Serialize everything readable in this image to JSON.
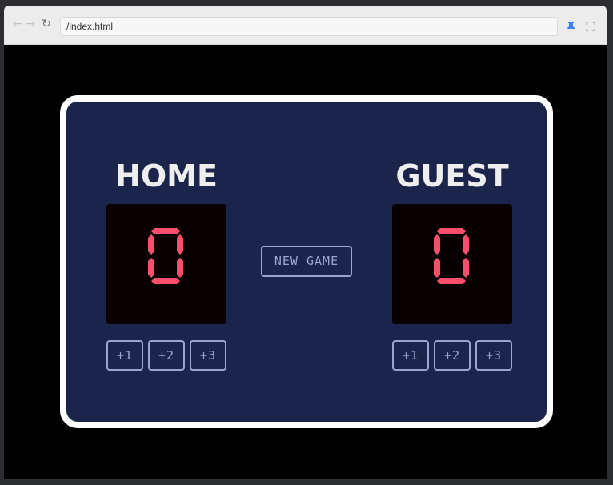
{
  "browser": {
    "url": "/index.html"
  },
  "scoreboard": {
    "new_game_label": "NEW GAME",
    "home": {
      "name": "HOME",
      "score": "0",
      "buttons": [
        "+1",
        "+2",
        "+3"
      ]
    },
    "guest": {
      "name": "GUEST",
      "score": "0",
      "buttons": [
        "+1",
        "+2",
        "+3"
      ]
    }
  },
  "colors": {
    "board_bg": "#1b244a",
    "board_border": "#ffffff",
    "score_bg": "#080001",
    "score_digit": "#f94f6d",
    "button_outline": "#9aa5ce",
    "team_name": "#eeeeee"
  }
}
